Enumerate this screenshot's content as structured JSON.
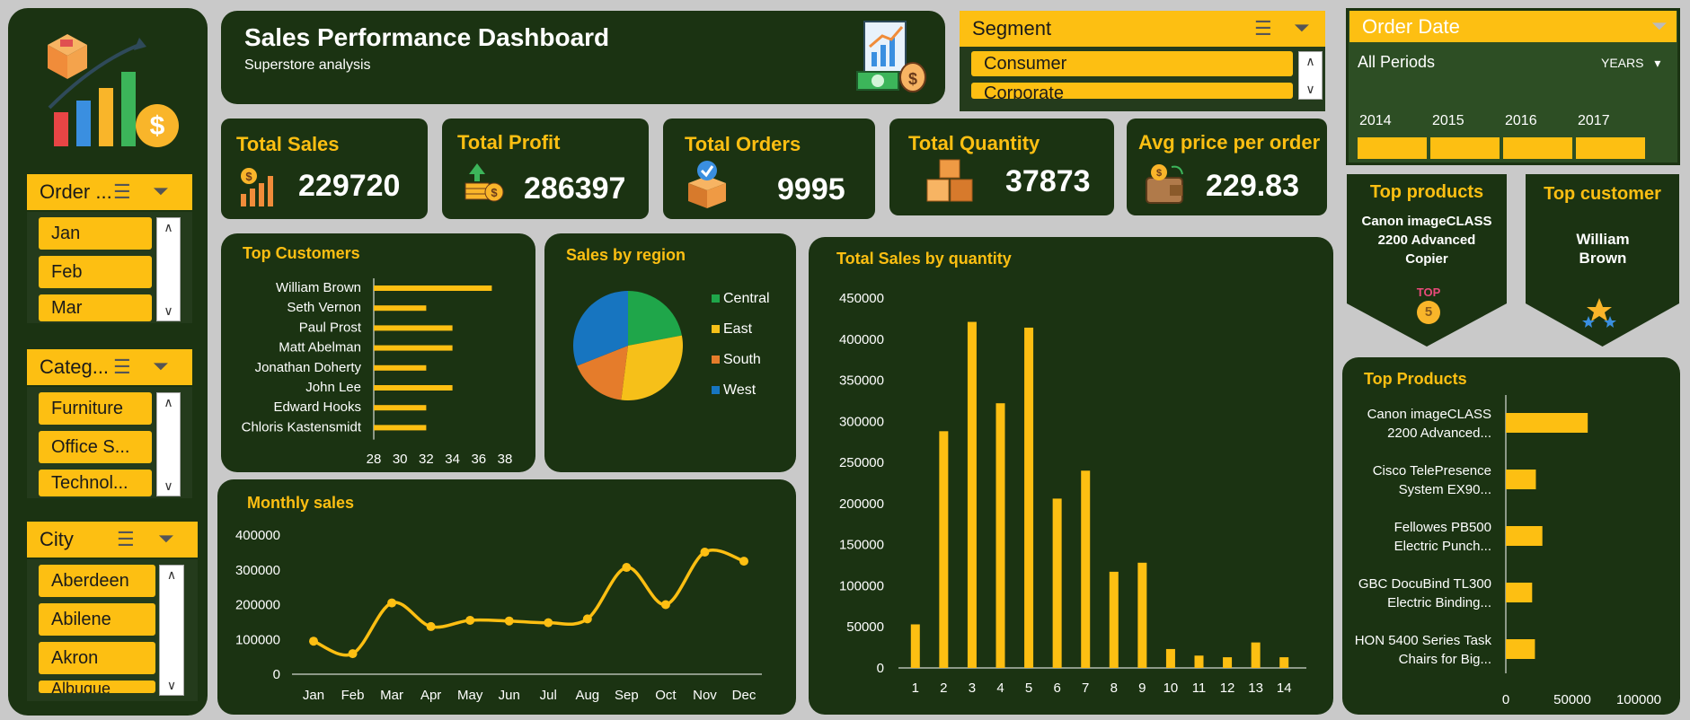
{
  "header": {
    "title": "Sales Performance Dashboard",
    "subtitle": "Superstore analysis"
  },
  "segment": {
    "title": "Segment",
    "items": [
      "Consumer",
      "Corporate"
    ]
  },
  "order_date": {
    "title": "Order Date",
    "period_label": "All Periods",
    "level": "YEARS",
    "years": [
      "2014",
      "2015",
      "2016",
      "2017"
    ]
  },
  "slicer_month": {
    "title": "Order ...",
    "items": [
      "Jan",
      "Feb",
      "Mar"
    ]
  },
  "slicer_category": {
    "title": "Categ...",
    "items": [
      "Furniture",
      "Office S...",
      "Technol..."
    ]
  },
  "slicer_city": {
    "title": "City",
    "items": [
      "Aberdeen",
      "Abilene",
      "Akron",
      "Albuque"
    ]
  },
  "kpis": [
    {
      "label": "Total Sales",
      "value": "229720"
    },
    {
      "label": "Total Profit",
      "value": "286397"
    },
    {
      "label": "Total Orders",
      "value": "9995"
    },
    {
      "label": "Total Quantity",
      "value": "37873"
    },
    {
      "label": "Avg price per order",
      "value": "229.83"
    }
  ],
  "top_products_card": {
    "title": "Top products",
    "value": "Canon imageCLASS 2200 Advanced Copier",
    "badge": "TOP",
    "badge_num": "5"
  },
  "top_customer_card": {
    "title": "Top customer",
    "value": "William Brown"
  },
  "colors": {
    "panel": "#1b3312",
    "accent": "#fdbf12",
    "background": "#c9c9c9"
  },
  "chart_data": [
    {
      "type": "bar",
      "title": "Top Customers",
      "orientation": "horizontal",
      "categories": [
        "William Brown",
        "Seth Vernon",
        "Paul Prost",
        "Matt Abelman",
        "Jonathan Doherty",
        "John Lee",
        "Edward Hooks",
        "Chloris Kastensmidt"
      ],
      "values": [
        37,
        32,
        34,
        34,
        32,
        34,
        32,
        32
      ],
      "xlim": [
        28,
        38
      ],
      "xticks": [
        "28",
        "30",
        "32",
        "34",
        "36",
        "38"
      ]
    },
    {
      "type": "pie",
      "title": "Sales by region",
      "categories": [
        "Central",
        "East",
        "South",
        "West"
      ],
      "values": [
        22,
        30,
        17,
        31
      ],
      "colors": [
        "#1fa64a",
        "#f6c019",
        "#e57c2b",
        "#1775c0"
      ],
      "legend": "right"
    },
    {
      "type": "bar",
      "title": "Total Sales by quantity",
      "categories": [
        "1",
        "2",
        "3",
        "4",
        "5",
        "6",
        "7",
        "8",
        "9",
        "10",
        "11",
        "12",
        "13",
        "14"
      ],
      "values": [
        53000,
        288000,
        421000,
        322000,
        414000,
        206000,
        240000,
        117000,
        128000,
        23000,
        15000,
        13000,
        31000,
        13000
      ],
      "ylim": [
        0,
        450000
      ],
      "yticks": [
        "0",
        "50000",
        "100000",
        "150000",
        "200000",
        "250000",
        "300000",
        "350000",
        "400000",
        "450000"
      ]
    },
    {
      "type": "bar",
      "title": "Top Products",
      "orientation": "horizontal",
      "categories": [
        "Canon imageCLASS 2200 Advanced...",
        "Cisco TelePresence System EX90...",
        "Fellowes PB500 Electric Punch...",
        "GBC DocuBind TL300 Electric Binding...",
        "HON 5400 Series Task Chairs for Big..."
      ],
      "values": [
        61600,
        22600,
        27500,
        19800,
        21900
      ],
      "xlim": [
        0,
        100000
      ],
      "xticks": [
        "0",
        "50000",
        "100000"
      ]
    },
    {
      "type": "line",
      "title": "Monthly sales",
      "categories": [
        "Jan",
        "Feb",
        "Mar",
        "Apr",
        "May",
        "Jun",
        "Jul",
        "Aug",
        "Sep",
        "Oct",
        "Nov",
        "Dec"
      ],
      "values": [
        95000,
        59000,
        205000,
        137000,
        155000,
        153000,
        148000,
        159000,
        307000,
        200000,
        351000,
        325000
      ],
      "ylim": [
        0,
        400000
      ],
      "yticks": [
        "0",
        "100000",
        "200000",
        "300000",
        "400000"
      ]
    }
  ]
}
